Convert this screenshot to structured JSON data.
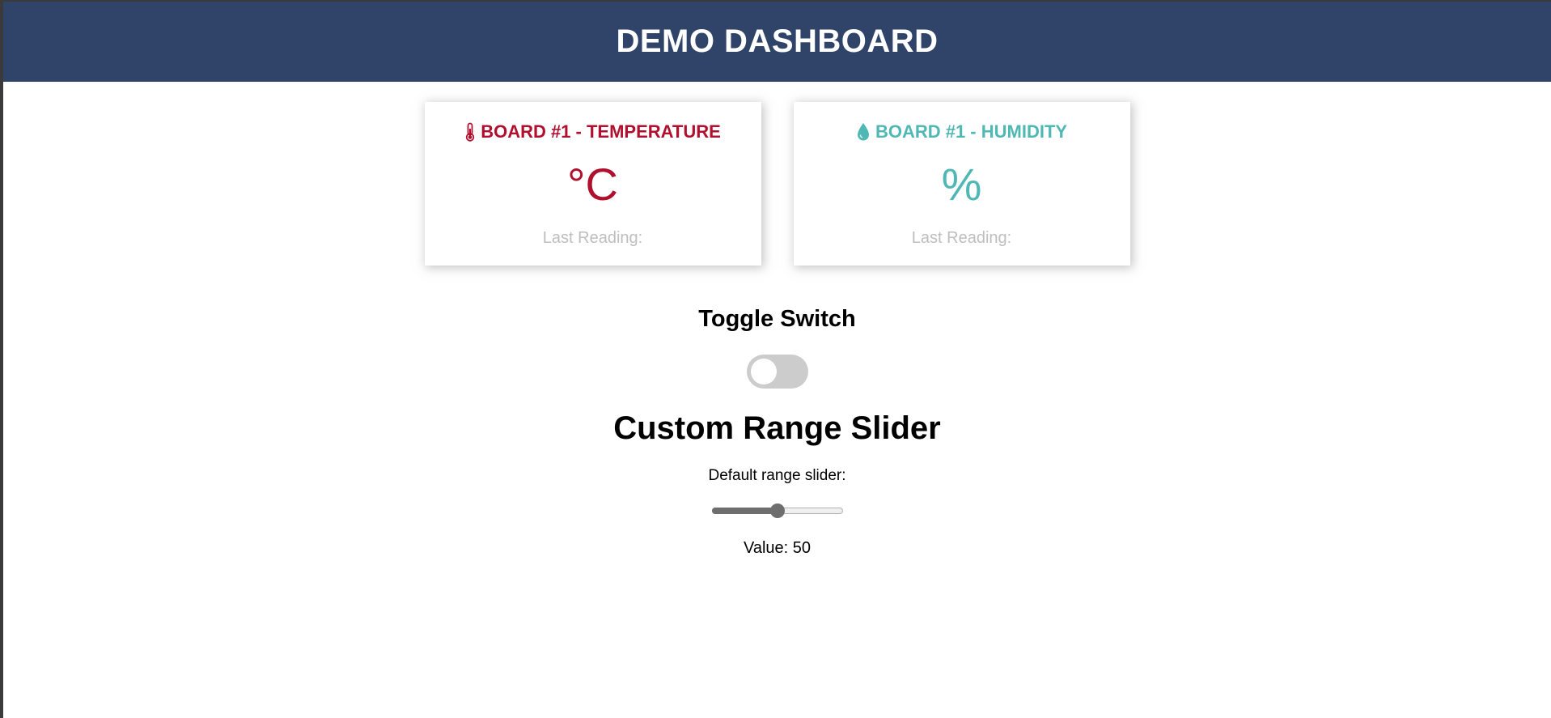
{
  "header": {
    "title": "DEMO DASHBOARD"
  },
  "cards": [
    {
      "title": "BOARD #1 - TEMPERATURE",
      "value": "°C",
      "reading_label": "Last Reading:",
      "color": "#b10f2e",
      "icon": "thermometer-icon"
    },
    {
      "title": "BOARD #1 - HUMIDITY",
      "value": "%",
      "reading_label": "Last Reading:",
      "color": "#50b8b4",
      "icon": "droplet-icon"
    }
  ],
  "toggle": {
    "title": "Toggle Switch",
    "state": "off"
  },
  "slider": {
    "title": "Custom Range Slider",
    "label": "Default range slider:",
    "value": 50,
    "min": 0,
    "max": 100,
    "value_prefix": "Value: ",
    "value_text": "Value: 50"
  }
}
